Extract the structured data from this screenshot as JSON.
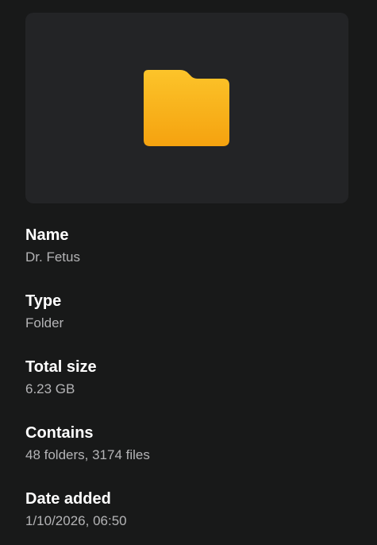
{
  "preview": {
    "icon": "folder-icon",
    "icon_colors": {
      "top": "#fcc42a",
      "bottom": "#f5a20f"
    }
  },
  "properties": [
    {
      "label": "Name",
      "value": "Dr. Fetus"
    },
    {
      "label": "Type",
      "value": "Folder"
    },
    {
      "label": "Total size",
      "value": "6.23 GB"
    },
    {
      "label": "Contains",
      "value": "48 folders, 3174 files"
    },
    {
      "label": "Date added",
      "value": "1/10/2026, 06:50"
    }
  ]
}
